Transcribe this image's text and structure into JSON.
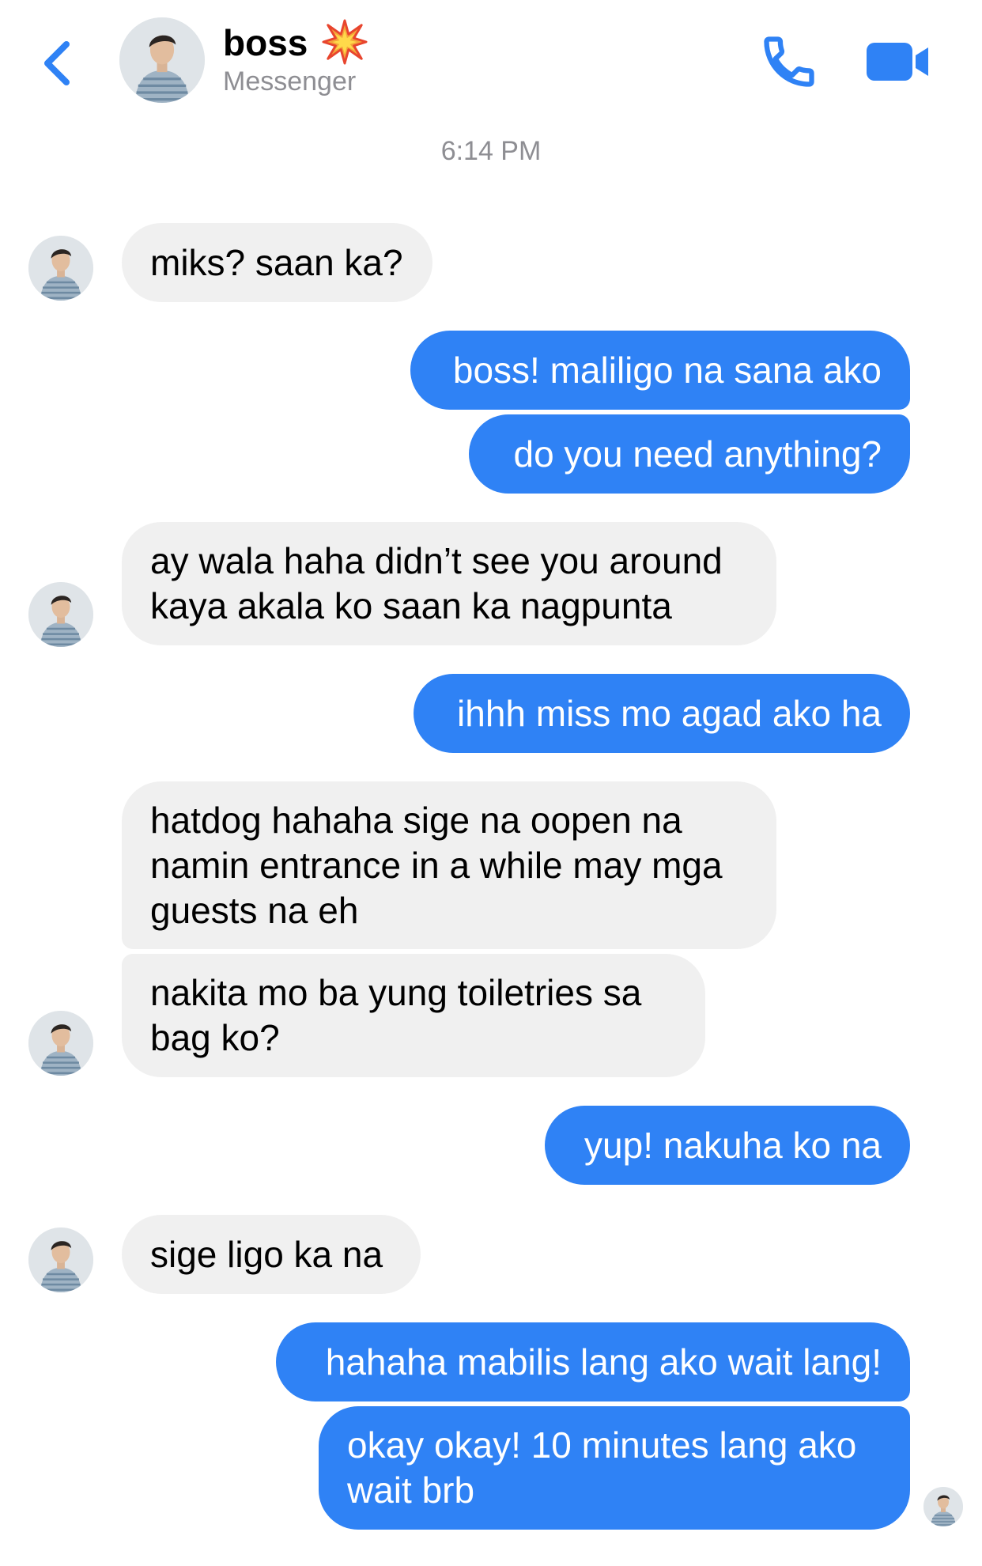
{
  "header": {
    "contact_name": "boss",
    "name_emoji_icon": "collision-emoji-icon",
    "subtitle": "Messenger",
    "back_icon": "chevron-left-icon",
    "call_icon": "phone-icon",
    "video_icon": "video-camera-icon",
    "accent_color": "#2f82f5"
  },
  "chat": {
    "timestamp": "6:14 PM",
    "incoming_bubble_color": "#f0f0f0",
    "outgoing_bubble_color": "#2f82f5",
    "messages": [
      {
        "sender": "contact",
        "text": "miks? saan ka?"
      },
      {
        "sender": "me",
        "text": "boss! maliligo na sana ako"
      },
      {
        "sender": "me",
        "text": "do you need anything?"
      },
      {
        "sender": "contact",
        "text": "ay wala haha didn’t see you around\nkaya akala ko saan ka nagpunta"
      },
      {
        "sender": "me",
        "text": "ihhh miss mo agad ako ha"
      },
      {
        "sender": "contact",
        "text": "hatdog hahaha sige na oopen na\nnamin entrance in a while may mga\nguests na eh"
      },
      {
        "sender": "contact",
        "text": "nakita mo ba yung toiletries sa\nbag ko?"
      },
      {
        "sender": "me",
        "text": "yup! nakuha ko na"
      },
      {
        "sender": "contact",
        "text": "sige ligo ka na"
      },
      {
        "sender": "me",
        "text": "hahaha mabilis lang ako wait lang!"
      },
      {
        "sender": "me",
        "text": "okay okay! 10 minutes lang ako\nwait brb"
      }
    ]
  }
}
